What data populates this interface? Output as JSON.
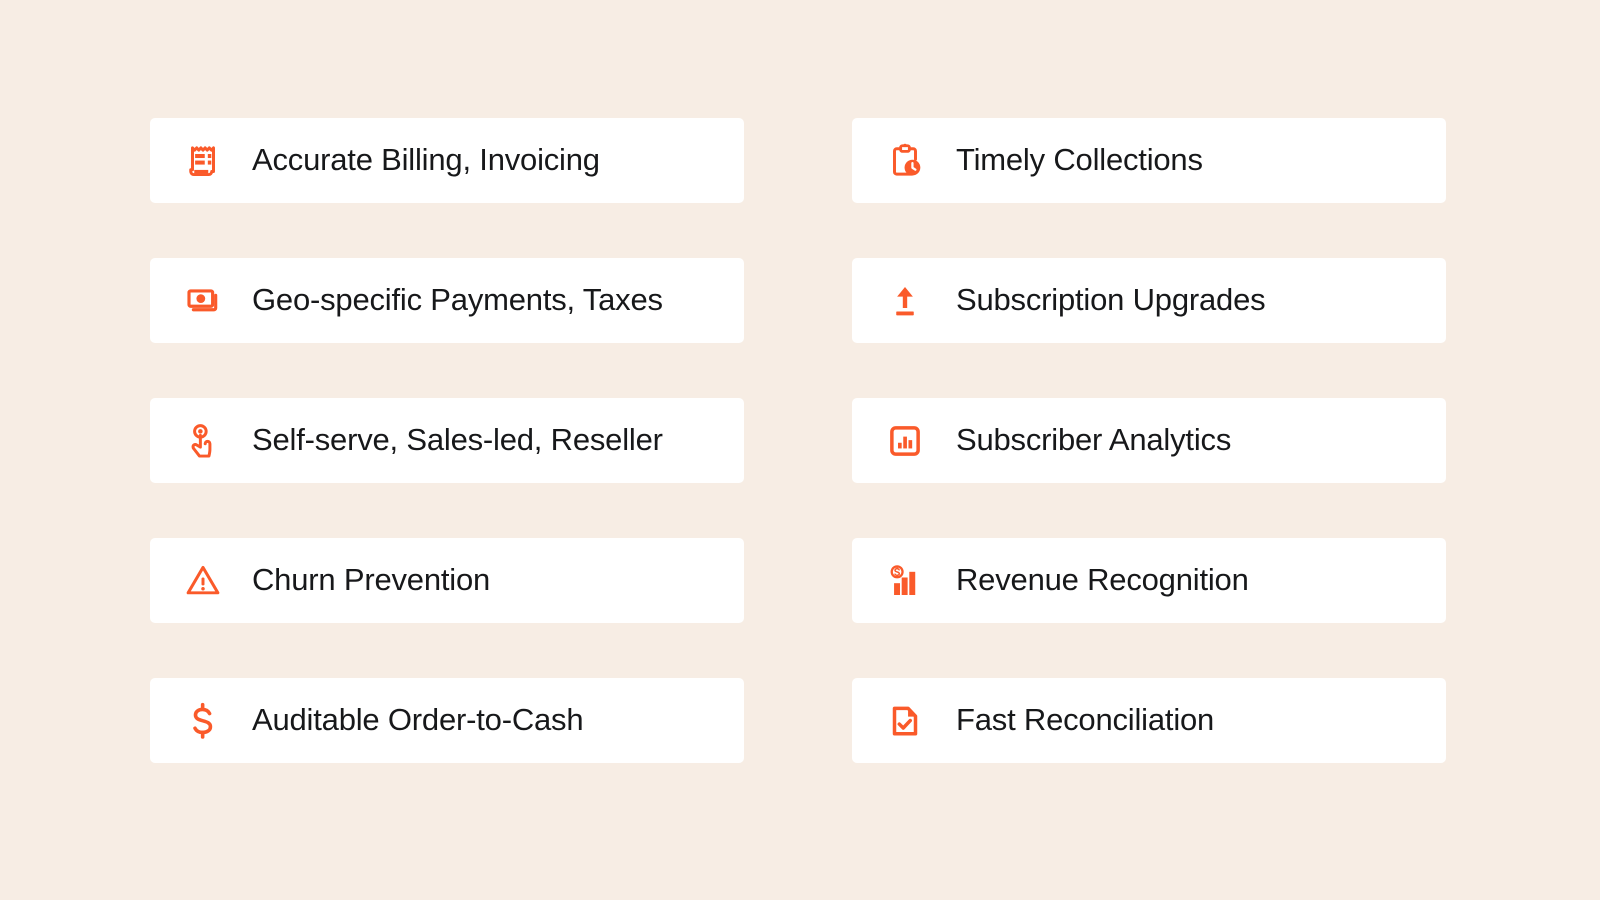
{
  "theme": {
    "background_color": "#F7EDE4",
    "card_background_color": "#FFFFFF",
    "accent_color": "#FA5A2A",
    "text_color": "#17181A"
  },
  "columns": [
    {
      "name": "left-column",
      "cards": [
        {
          "label": "Accurate Billing, Invoicing",
          "icon": "receipt-icon"
        },
        {
          "label": "Geo-specific Payments, Taxes",
          "icon": "banknotes-icon"
        },
        {
          "label": "Self-serve, Sales-led, Reseller",
          "icon": "tap-hand-icon"
        },
        {
          "label": "Churn Prevention",
          "icon": "warning-triangle-icon"
        },
        {
          "label": "Auditable Order-to-Cash",
          "icon": "dollar-sign-icon"
        }
      ]
    },
    {
      "name": "right-column",
      "cards": [
        {
          "label": "Timely Collections",
          "icon": "clipboard-clock-icon"
        },
        {
          "label": "Subscription Upgrades",
          "icon": "upload-arrow-icon"
        },
        {
          "label": "Subscriber Analytics",
          "icon": "bar-chart-box-icon"
        },
        {
          "label": "Revenue Recognition",
          "icon": "dollar-bar-chart-icon"
        },
        {
          "label": "Fast Reconciliation",
          "icon": "document-check-icon"
        }
      ]
    }
  ]
}
